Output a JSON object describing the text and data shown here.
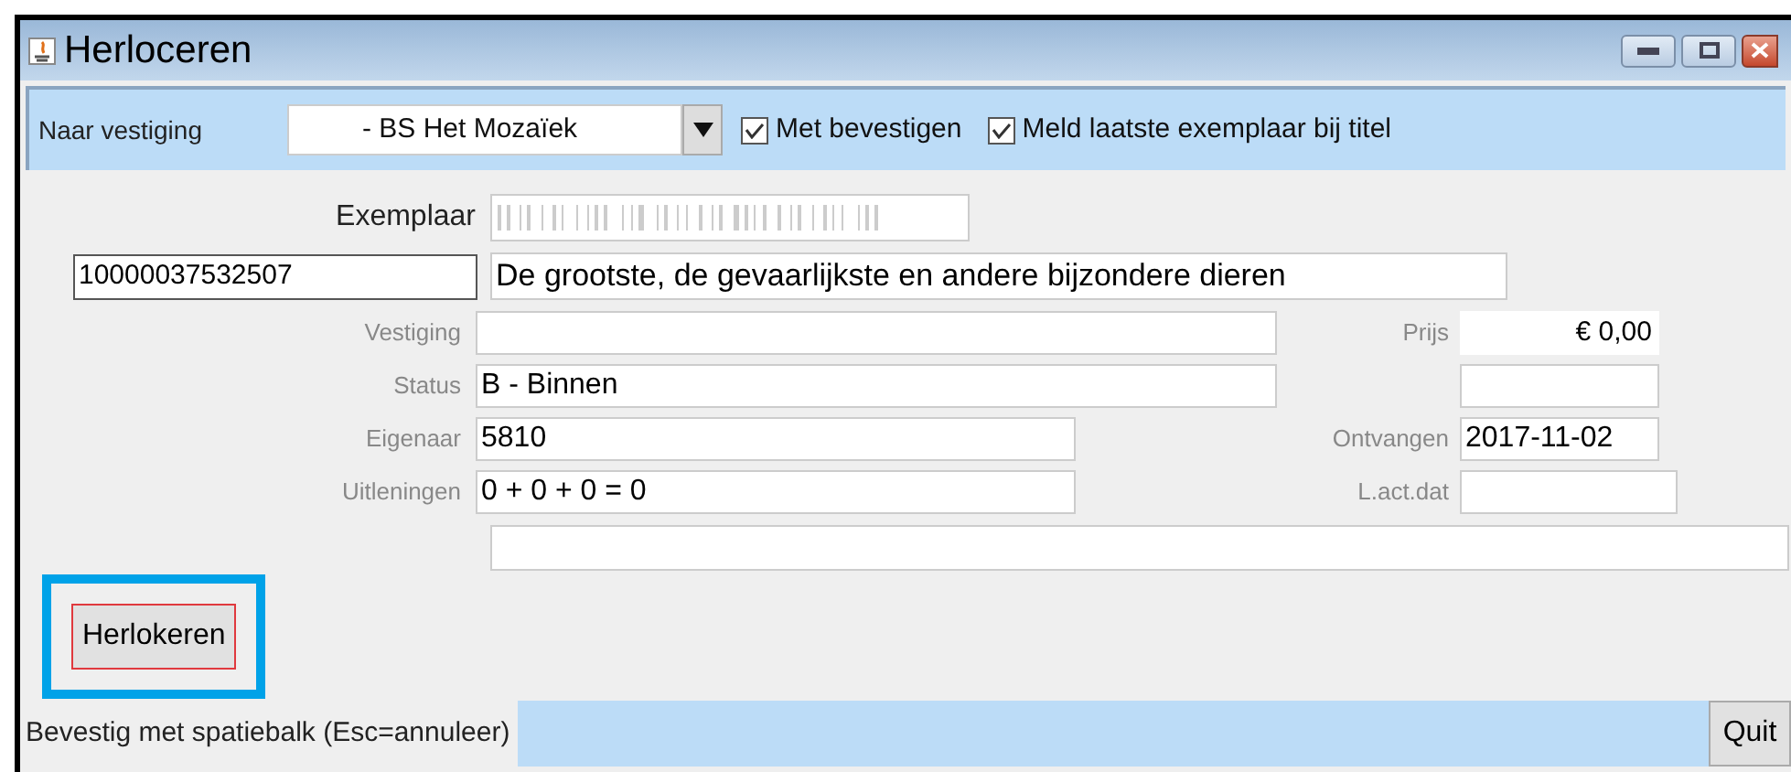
{
  "window": {
    "title": "Herloceren"
  },
  "toolbar": {
    "branch_label": "Naar vestiging",
    "branch_value": "- BS Het Mozaïek",
    "checkboxes": [
      {
        "label": "Met bevestigen",
        "checked": true
      },
      {
        "label": "Meld laatste exemplaar bij titel",
        "checked": true
      }
    ]
  },
  "exemplaar": {
    "label": "Exemplaar"
  },
  "item": {
    "barcode": "10000037532507",
    "title": "De grootste, de gevaarlijkste en andere bijzondere dieren"
  },
  "details": [
    {
      "left": {
        "label": "Vestiging"
      },
      "right": {
        "kind": "plain",
        "label": "Prijs",
        "value": "€ 0,00"
      }
    },
    {
      "left": {
        "label": "Status",
        "value": "B - Binnen"
      },
      "right": {
        "kind": "field"
      }
    },
    {
      "left": {
        "label": "Eigenaar",
        "value": "5810"
      },
      "right": {
        "kind": "field",
        "label": "Ontvangen",
        "value": "2017-11-02"
      }
    },
    {
      "left": {
        "label": "Uitleningen",
        "value": "0 + 0 + 0 = 0"
      },
      "right": {
        "kind": "field",
        "label": "L.act.dat"
      }
    }
  ],
  "action_button": {
    "label": "Herlokeren",
    "highlighted": true
  },
  "status_bar": {
    "message": "Bevestig met spatiebalk (Esc=annuleer)",
    "quit": "Quit"
  }
}
